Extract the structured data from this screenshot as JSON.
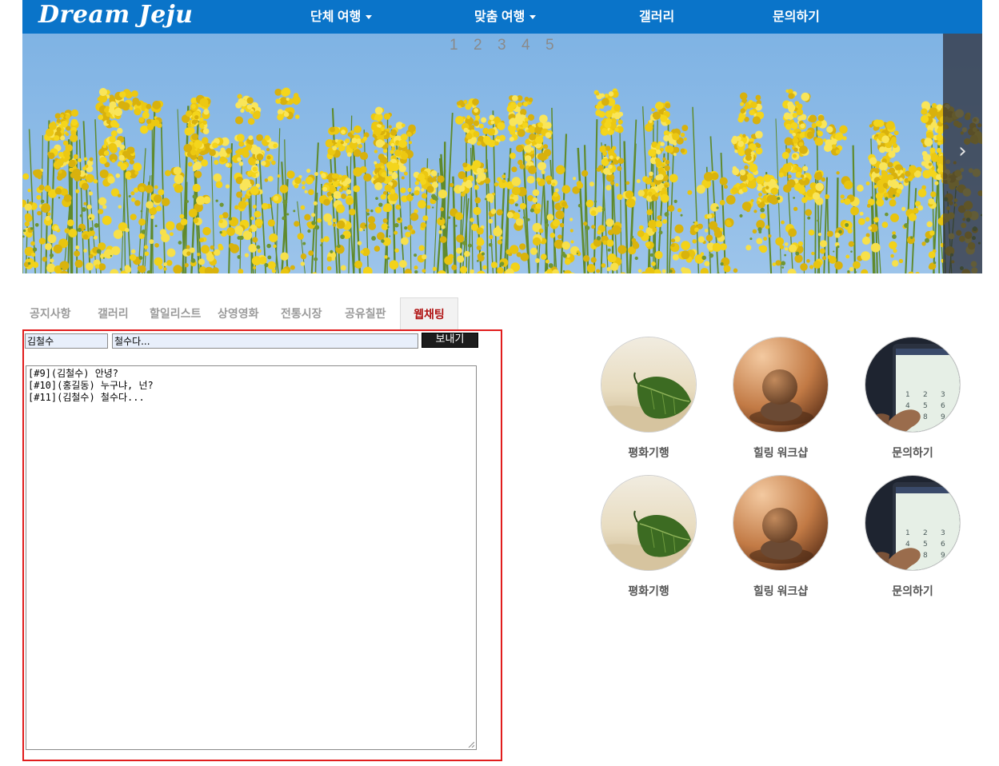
{
  "brand": "Dream Jeju",
  "nav": {
    "items": [
      {
        "label": "단체 여행",
        "dropdown": true
      },
      {
        "label": "맞춤 여행",
        "dropdown": true
      },
      {
        "label": "갤러리",
        "dropdown": false
      },
      {
        "label": "문의하기",
        "dropdown": false
      }
    ]
  },
  "carousel": {
    "pages": [
      "1",
      "2",
      "3",
      "4",
      "5"
    ],
    "next_label": "›"
  },
  "tabs": [
    {
      "label": "공지사항",
      "active": false
    },
    {
      "label": "갤러리",
      "active": false
    },
    {
      "label": "할일리스트",
      "active": false
    },
    {
      "label": "상영영화",
      "active": false
    },
    {
      "label": "전통시장",
      "active": false
    },
    {
      "label": "공유칠판",
      "active": false
    },
    {
      "label": "웹채팅",
      "active": true
    }
  ],
  "chat": {
    "name_value": "김철수",
    "message_value": "철수다...",
    "send_label": "보내기",
    "log": [
      "[#9](김철수) 안녕?",
      "[#10](홍길동) 누구냐, 넌?",
      "[#11](김철수) 철수다..."
    ]
  },
  "cards": [
    {
      "label": "평화기행",
      "image": "leaf-on-sand"
    },
    {
      "label": "힐링 워크샵",
      "image": "stacked-stones"
    },
    {
      "label": "문의하기",
      "image": "phone-keypad"
    },
    {
      "label": "평화기행",
      "image": "leaf-on-sand"
    },
    {
      "label": "힐링 워크샵",
      "image": "stacked-stones"
    },
    {
      "label": "문의하기",
      "image": "phone-keypad"
    }
  ],
  "colors": {
    "nav_bg": "#0a74c9",
    "active_tab": "#b01313",
    "panel_border": "#e11d1d",
    "sky": "#79aee0",
    "flowers": "#f2d21a"
  }
}
